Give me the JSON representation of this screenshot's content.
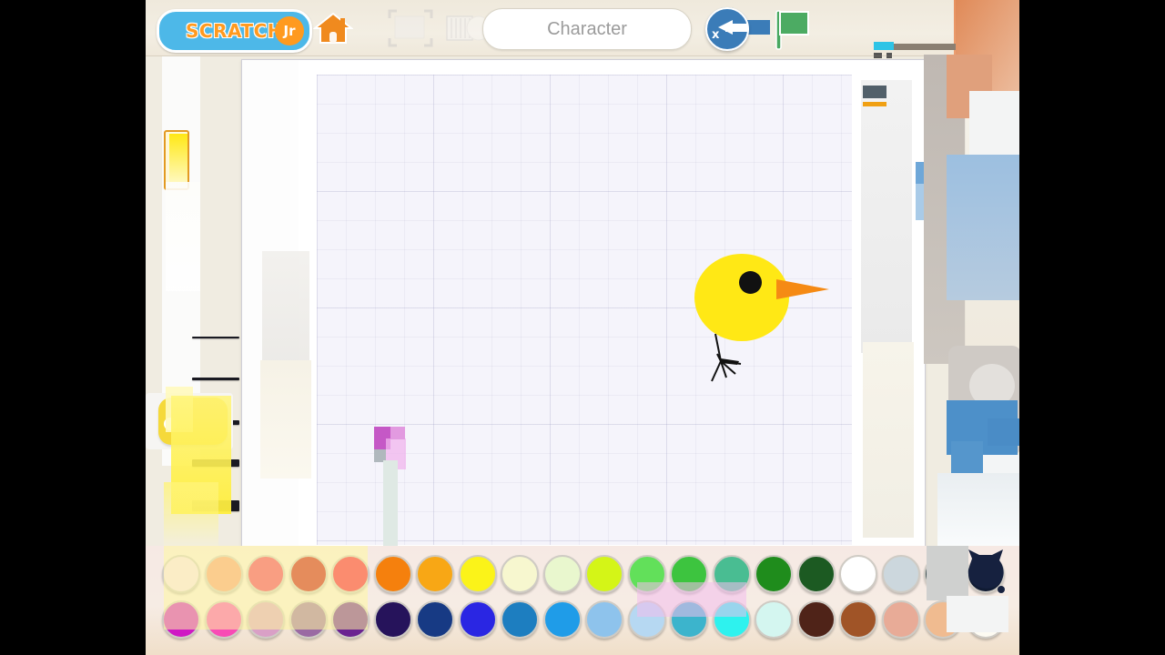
{
  "app": {
    "name": "ScratchJr",
    "logo_text": "SCRATCH",
    "logo_badge": "Jr"
  },
  "topbar": {
    "home_icon": "home-icon",
    "select_tool_icon": "crop-select-icon",
    "page_tool_icon": "page-grid-icon",
    "undo_icon": "undo-arrow-icon",
    "undo_label": "x",
    "flag_icon": "green-flag-icon",
    "name_field": {
      "value": "",
      "placeholder": "Character"
    }
  },
  "left_tools": {
    "thumbnail_label": "character-thumbnail",
    "stroke_widths": [
      2,
      3,
      5,
      8,
      12
    ],
    "paint_tool_icon": "paint-tool-icon"
  },
  "canvas": {
    "grid_visible": true,
    "background_color": "#f5f4fb",
    "drawing_name": "yellow-bird",
    "shapes": {
      "body_color": "#ffe815",
      "eye_color": "#111111",
      "beak_color": "#f58a14",
      "leg_color": "#111111"
    }
  },
  "palette": {
    "row1": [
      "#f7dff4",
      "#f79a78",
      "#f2315e",
      "#c60a0a",
      "#f50b34",
      "#f5800d",
      "#f8a715",
      "#fbf319",
      "#f7f7cf",
      "#e9f7ce",
      "#d4f517",
      "#62e05a",
      "#3dc43f",
      "#49bd92",
      "#1f8c1c",
      "#1c5a22",
      "#ffffff",
      "#ccd7dd",
      "#3d4f52",
      "#101b33"
    ],
    "row2": [
      "#cf19c4",
      "#f84bb5",
      "#d9a0c6",
      "#9a6aa3",
      "#6a2391",
      "#26135b",
      "#173a84",
      "#2a26e3",
      "#1d7ec0",
      "#1f9ce8",
      "#8ec3ec",
      "#b6d8f2",
      "#3cb4cc",
      "#2ef2ee",
      "#d4f6f0",
      "#4f2318",
      "#a05427",
      "#e8ab97",
      "#f0bb90",
      "#fdfbf2"
    ]
  }
}
